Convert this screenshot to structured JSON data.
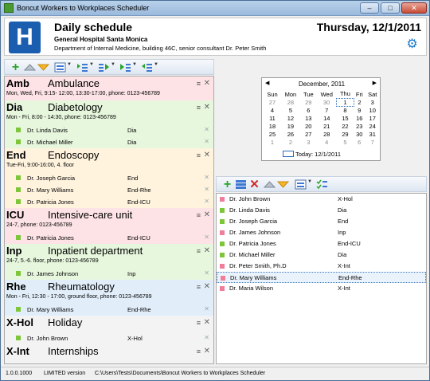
{
  "window": {
    "title": "Boncut Workers to Workplaces Scheduler",
    "minimize": "–",
    "maximize": "□",
    "close": "✕"
  },
  "header": {
    "title": "Daily schedule",
    "hospital": "General Hospital Santa Monica",
    "department_line": "Department of Internal Medicine, building 46C, senior consultant Dr. Peter Smith",
    "date": "Thursday, 12/1/2011",
    "logo_letter": "H"
  },
  "departments": [
    {
      "code": "Amb",
      "name": "Ambulance",
      "info": "Mon, Wed, Fri, 9:15- 12:00, 13:30-17:00, phone: 0123-456789",
      "color": "#fde3e6",
      "staff": []
    },
    {
      "code": "Dia",
      "name": "Diabetology",
      "info": "Mon - Fri, 8:00 - 14:30, phone: 0123-456789",
      "color": "#e7f7dd",
      "staff": [
        {
          "name": "Dr. Linda Davis",
          "code": "Dia"
        },
        {
          "name": "Dr. Michael Miller",
          "code": "Dia"
        }
      ]
    },
    {
      "code": "End",
      "name": "Endoscopy",
      "info": "Tue-Fri, 9:00-16:00, 4. floor",
      "color": "#fff3de",
      "staff": [
        {
          "name": "Dr. Joseph Garcia",
          "code": "End"
        },
        {
          "name": "Dr. Mary Williams",
          "code": "End-Rhe"
        },
        {
          "name": "Dr. Patricia Jones",
          "code": "End-ICU"
        }
      ]
    },
    {
      "code": "ICU",
      "name": "Intensive-care unit",
      "info": "24-7, phone: 0123-456789",
      "color": "#fde3e6",
      "staff": [
        {
          "name": "Dr. Patricia Jones",
          "code": "End-ICU"
        }
      ]
    },
    {
      "code": "Inp",
      "name": "Inpatient department",
      "info": "24-7, 5.-6. floor, phone: 0123-456789",
      "color": "#e7f7dd",
      "staff": [
        {
          "name": "Dr. James Johnson",
          "code": "Inp"
        }
      ]
    },
    {
      "code": "Rhe",
      "name": "Rheumatology",
      "info": "Mon - Fri, 12:30 - 17:00, ground floor, phone: 0123-456789",
      "color": "#e1eefa",
      "staff": [
        {
          "name": "Dr. Mary Williams",
          "code": "End-Rhe"
        }
      ]
    },
    {
      "code": "X-Hol",
      "name": "Holiday",
      "info": "",
      "color": "#f3f3f3",
      "staff": [
        {
          "name": "Dr. John Brown",
          "code": "X-Hol"
        }
      ]
    },
    {
      "code": "X-Int",
      "name": "Internships",
      "info": "",
      "color": "#f3f3f3",
      "staff": [
        {
          "name": "Dr. Maria Wilson",
          "code": "X-Int"
        },
        {
          "name": "Dr. Peter Smith, Ph.D",
          "code": "X-Int"
        }
      ]
    }
  ],
  "calendar": {
    "month": "December, 2011",
    "weekdays": [
      "Sun",
      "Mon",
      "Tue",
      "Wed",
      "Thu",
      "Fri",
      "Sat"
    ],
    "weeks": [
      [
        "27",
        "28",
        "29",
        "30",
        "1",
        "2",
        "3"
      ],
      [
        "4",
        "5",
        "6",
        "7",
        "8",
        "9",
        "10"
      ],
      [
        "11",
        "12",
        "13",
        "14",
        "15",
        "16",
        "17"
      ],
      [
        "18",
        "19",
        "20",
        "21",
        "22",
        "23",
        "24"
      ],
      [
        "25",
        "26",
        "27",
        "28",
        "29",
        "30",
        "31"
      ],
      [
        "1",
        "2",
        "3",
        "4",
        "5",
        "6",
        "7"
      ]
    ],
    "today_label": "Today: 12/1/2011",
    "prev": "◀",
    "next": "▶"
  },
  "workers": [
    {
      "name": "Dr. John Brown",
      "code": "X-Hol",
      "color": "#f07d9a"
    },
    {
      "name": "Dr. Linda Davis",
      "code": "Dia",
      "color": "#7dc63a"
    },
    {
      "name": "Dr. Joseph Garcia",
      "code": "End",
      "color": "#7dc63a"
    },
    {
      "name": "Dr. James Johnson",
      "code": "Inp",
      "color": "#f07d9a"
    },
    {
      "name": "Dr. Patricia Jones",
      "code": "End-ICU",
      "color": "#7dc63a"
    },
    {
      "name": "Dr. Michael Miller",
      "code": "Dia",
      "color": "#7dc63a"
    },
    {
      "name": "Dr. Peter Smith, Ph.D",
      "code": "X-Int",
      "color": "#f07d9a"
    },
    {
      "name": "Dr. Mary Williams",
      "code": "End-Rhe",
      "color": "#f07d9a"
    },
    {
      "name": "Dr. Maria Wilson",
      "code": "X-Int",
      "color": "#f07d9a"
    }
  ],
  "status": {
    "version": "1.0.0.1000",
    "license": "LIMITED version",
    "path": "C:\\Users\\Tests\\Documents\\Boncut Workers to Workplaces Scheduler"
  }
}
